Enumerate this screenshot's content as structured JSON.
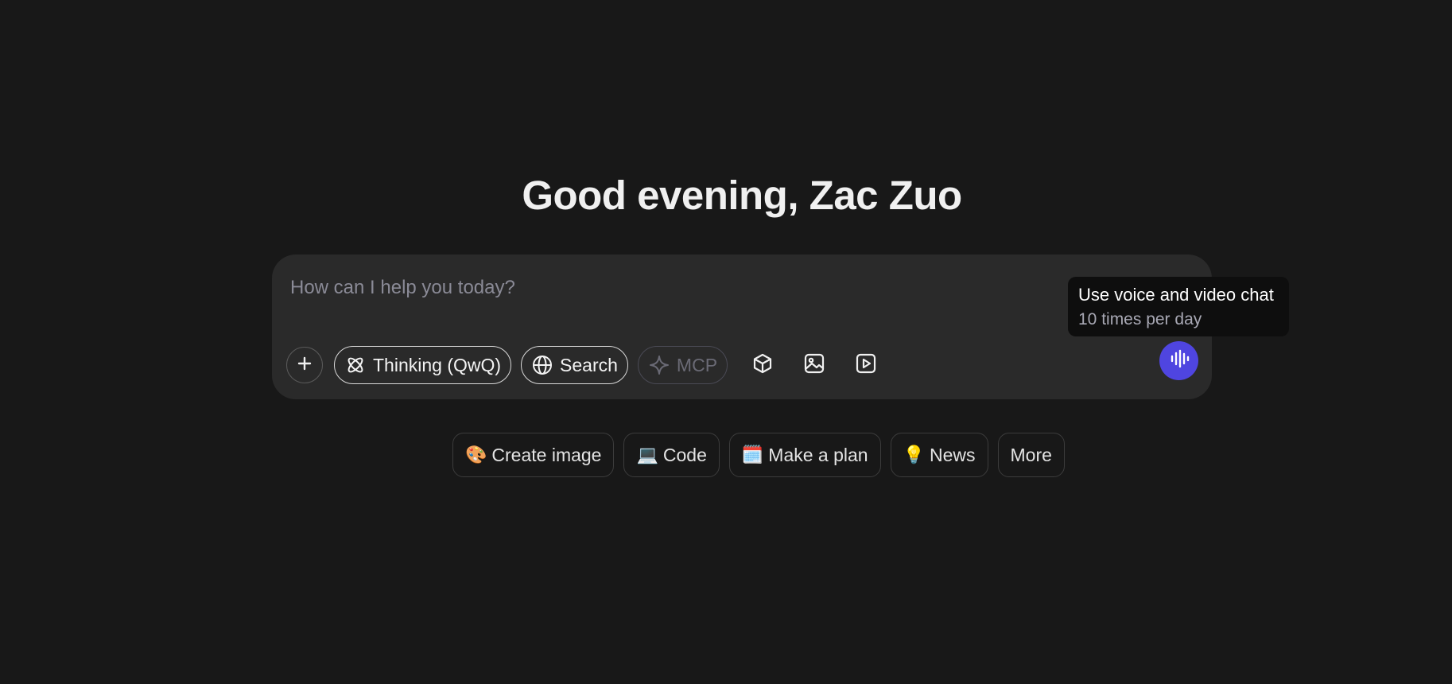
{
  "greeting": "Good evening, Zac Zuo",
  "composer": {
    "placeholder": "How can I help you today?",
    "attach_icon": "plus-icon",
    "pills": [
      {
        "label": "Thinking (QwQ)",
        "icon": "atom-icon",
        "enabled": true
      },
      {
        "label": "Search",
        "icon": "globe-icon",
        "enabled": true
      },
      {
        "label": "MCP",
        "icon": "sparkle-icon",
        "enabled": false
      }
    ],
    "tool_icons": [
      "cube-icon",
      "image-icon",
      "video-play-icon"
    ],
    "voice_button": {
      "icon": "voice-waveform-icon",
      "color": "#4f45e0"
    }
  },
  "tooltip": {
    "title": "Use voice and video chat",
    "subtitle": "10 times per day"
  },
  "suggestions": [
    {
      "emoji": "🎨",
      "label": "Create image"
    },
    {
      "emoji": "💻",
      "label": "Code"
    },
    {
      "emoji": "🗓️",
      "label": "Make a plan"
    },
    {
      "emoji": "💡",
      "label": "News"
    },
    {
      "emoji": "",
      "label": "More"
    }
  ],
  "colors": {
    "background": "#181818",
    "composer": "#2a2a2a",
    "accent": "#4f45e0"
  }
}
